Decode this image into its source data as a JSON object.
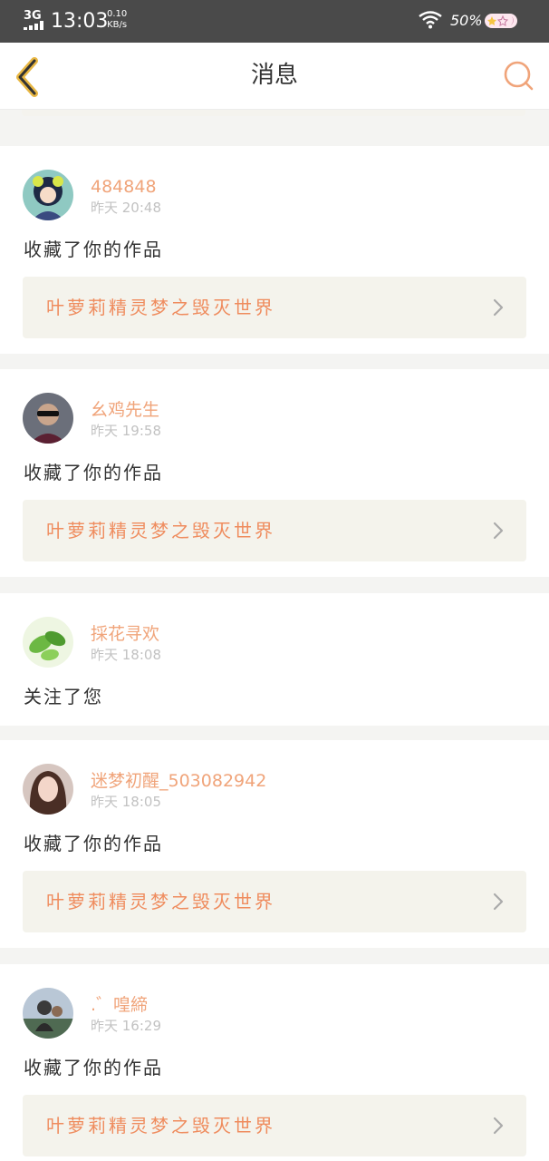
{
  "status_bar": {
    "network": "3G",
    "time": "13:03",
    "speed_value": "0.10",
    "speed_unit": "KB/s",
    "battery": "50%"
  },
  "header": {
    "title": "消息",
    "back_icon": "chevron-left-icon",
    "search_icon": "search-icon"
  },
  "colors": {
    "accent": "#f0a47a",
    "work_text": "#ef8c5e",
    "status_bar": "#4a4a4a",
    "card_inner": "#f4f3ec"
  },
  "messages": [
    {
      "username": "484848",
      "time": "昨天 20:48",
      "action": "收藏了你的作品",
      "work": "叶萝莉精灵梦之毁灭世界"
    },
    {
      "username": "幺鸡先生",
      "time": "昨天 19:58",
      "action": "收藏了你的作品",
      "work": "叶萝莉精灵梦之毁灭世界"
    },
    {
      "username": "採花寻欢",
      "time": "昨天 18:08",
      "action": "关注了您"
    },
    {
      "username": "迷梦初醒_503082942",
      "time": "昨天 18:05",
      "action": "收藏了你的作品",
      "work": "叶萝莉精灵梦之毁灭世界"
    },
    {
      "username": ".゛喤締",
      "time": "昨天 16:29",
      "action": "收藏了你的作品",
      "work": "叶萝莉精灵梦之毁灭世界"
    }
  ]
}
